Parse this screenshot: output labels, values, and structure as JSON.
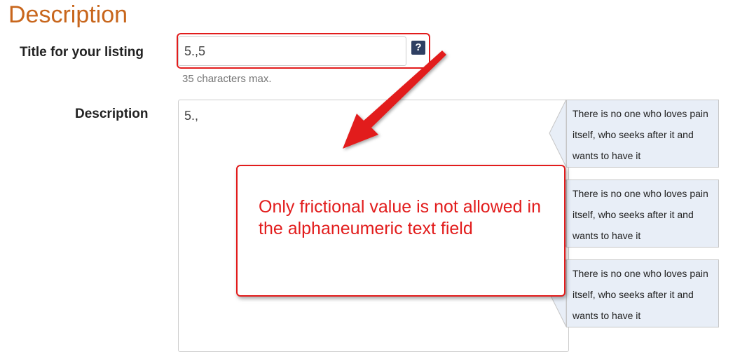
{
  "section_heading": "Description",
  "title_field": {
    "label": "Title for your listing",
    "value": "5.,5",
    "help_icon_glyph": "?",
    "hint": "35 characters max."
  },
  "description_field": {
    "label": "Description",
    "value": "5.,"
  },
  "tooltips": [
    {
      "text": "There is no one who loves pain itself, who seeks after it and wants to have it"
    },
    {
      "text": "There is no one who loves pain itself, who seeks after it and wants to have it"
    },
    {
      "text": "There is no one who loves pain itself, who seeks after it and wants to have it"
    }
  ],
  "annotation": {
    "text": "Only frictional value is not allowed in the alphaneumeric text field",
    "color": "#e21c1c"
  },
  "colors": {
    "heading": "#c8661c",
    "tooltip_bg": "#e8eef7",
    "help_icon_bg": "#2e3f62"
  }
}
